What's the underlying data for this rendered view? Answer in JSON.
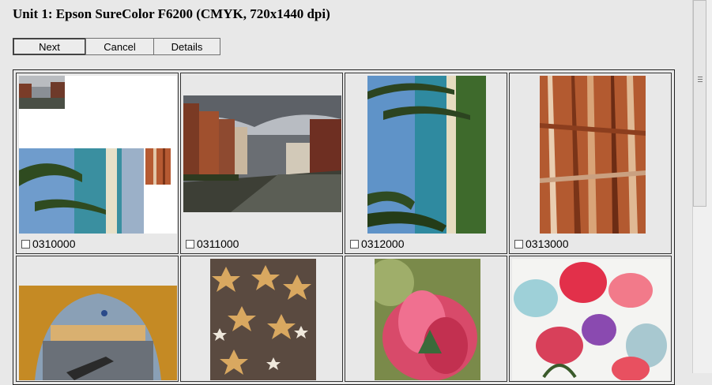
{
  "title": "Unit 1: Epson SureColor F6200 (CMYK, 720x1440 dpi)",
  "toolbar": {
    "next": "Next",
    "cancel": "Cancel",
    "details": "Details"
  },
  "cells": [
    {
      "label": "0310000",
      "checked": false
    },
    {
      "label": "0311000",
      "checked": false
    },
    {
      "label": "0312000",
      "checked": false
    },
    {
      "label": "0313000",
      "checked": false
    }
  ]
}
